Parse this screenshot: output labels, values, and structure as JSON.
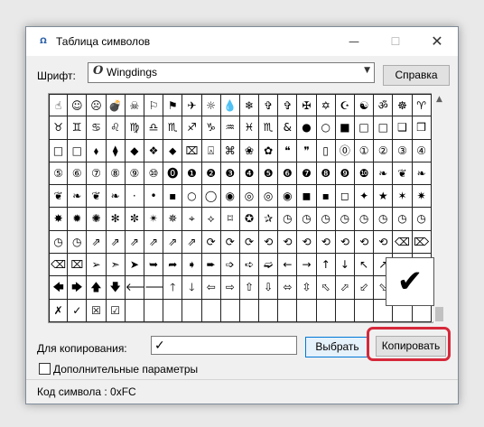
{
  "window": {
    "title": "Таблица символов",
    "app_icon": "charmap-icon",
    "minimize_glyph": "—",
    "maximize_glyph": "☐",
    "close_glyph": "✕"
  },
  "font": {
    "label": "Шрифт:",
    "selected": "Wingdings",
    "font_icon_glyph": "O",
    "dropdown_glyph": "▼",
    "help_label": "Справка"
  },
  "grid": {
    "rows": [
      [
        "☝",
        "☺",
        "☹",
        "💣",
        "☠",
        "⚐",
        "⚑",
        "✈",
        "☼",
        "💧",
        "❄",
        "✞",
        "✞",
        "✠",
        "✡",
        "☪",
        "☯",
        "ॐ",
        "☸",
        "♈"
      ],
      [
        "♉",
        "♊",
        "♋",
        "♌",
        "♍",
        "♎",
        "♏",
        "♐",
        "♑",
        "♒",
        "♓",
        "♏",
        "&",
        "●",
        "○",
        "■",
        "□",
        "□",
        "❑",
        "❒"
      ],
      [
        "□",
        "□",
        "⬧",
        "⧫",
        "◆",
        "❖",
        "⬥",
        "⌧",
        "⍓",
        "⌘",
        "❀",
        "✿",
        "❝",
        "❞",
        "▯",
        "⓪",
        "①",
        "②",
        "③",
        "④"
      ],
      [
        "⑤",
        "⑥",
        "⑦",
        "⑧",
        "⑨",
        "⑩",
        "⓿",
        "❶",
        "❷",
        "❸",
        "❹",
        "❺",
        "❻",
        "❼",
        "❽",
        "❾",
        "❿",
        "❧",
        "❦",
        "❧"
      ],
      [
        "❦",
        "❧",
        "❦",
        "❧",
        "·",
        "•",
        "▪",
        "○",
        "◯",
        "◉",
        "◎",
        "◎",
        "◉",
        "◼",
        "▪",
        "◻",
        "✦",
        "★",
        "✶",
        "✷"
      ],
      [
        "✸",
        "✹",
        "✺",
        "✻",
        "✼",
        "✴",
        "✵",
        "⌖",
        "⟡",
        "⌑",
        "✪",
        "✰",
        "◷",
        "◷",
        "◷",
        "◷",
        "◷",
        "◷",
        "◷",
        "◷"
      ],
      [
        "◷",
        "◷",
        "⇗",
        "⇗",
        "⇗",
        "⇗",
        "⇗",
        "⇗",
        "⟳",
        "⟳",
        "⟳",
        "⟲",
        "⟲",
        "⟲",
        "⟲",
        "⟲",
        "⟲",
        "⟲",
        "⌫",
        "⌦"
      ],
      [
        "⌫",
        "⌧",
        "➢",
        "➣",
        "➤",
        "➥",
        "➦",
        "➧",
        "➨",
        "➩",
        "➪",
        "➫",
        "←",
        "→",
        "↑",
        "↓",
        "↖",
        "↗",
        "↙",
        "↘"
      ],
      [
        "🡄",
        "🡆",
        "🡅",
        "🡇",
        "🡐",
        "🡒",
        "🡑",
        "🡓",
        "⇦",
        "⇨",
        "⇧",
        "⇩",
        "⬄",
        "⇳",
        "⬁",
        "⬀",
        "⬃",
        "⬂",
        "▭",
        "▫"
      ],
      [
        "✗",
        "✓",
        "☒",
        "☑",
        "",
        "",
        "",
        "",
        "",
        "",
        "",
        "",
        "",
        "",
        "",
        "",
        "",
        "",
        "",
        ""
      ]
    ]
  },
  "scroll_up_glyph": "▲",
  "magnifier_glyph": "✔",
  "copy": {
    "label": "Для копирования:",
    "value": "✓",
    "select_label": "Выбрать",
    "copy_label": "Копировать"
  },
  "advanced_label": "Дополнительные параметры",
  "status": "Код символа : 0xFC",
  "colors": {
    "highlight": "#d6283a",
    "select_border": "#0078d7"
  }
}
